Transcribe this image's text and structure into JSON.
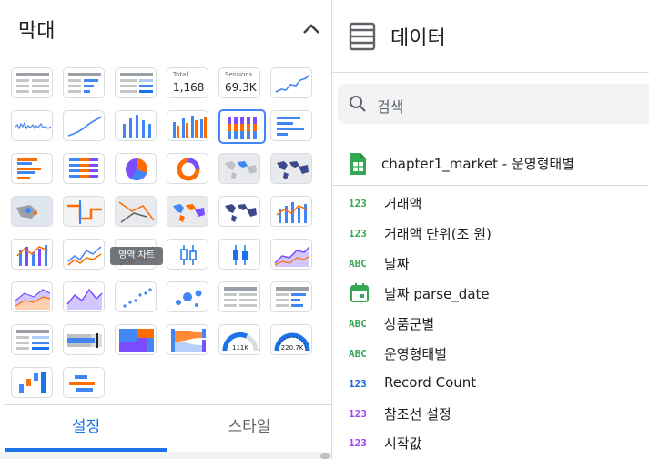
{
  "chart_panel": {
    "title": "막대",
    "scorecard_total": {
      "label": "Total",
      "value": "1,168"
    },
    "scorecard_sessions": {
      "label": "Sessions",
      "value": "69.3K"
    },
    "gauge_1_value": "111K",
    "gauge_2_value": "220.7K",
    "tooltip": "영역 차트",
    "tabs": [
      {
        "label": "설정",
        "active": true
      },
      {
        "label": "스타일",
        "active": false
      }
    ]
  },
  "data_panel": {
    "title": "데이터",
    "search_placeholder": "검색",
    "source_name": "chapter1_market - 운영형태별",
    "fields": [
      {
        "type": "123",
        "name": "거래액",
        "kind": "metric"
      },
      {
        "type": "123",
        "name": "거래액 단위(조 원)",
        "kind": "metric"
      },
      {
        "type": "ABC",
        "name": "날짜",
        "kind": "dimension"
      },
      {
        "type": "calendar",
        "name": "날짜 parse_date",
        "kind": "date"
      },
      {
        "type": "ABC",
        "name": "상품군별",
        "kind": "dimension"
      },
      {
        "type": "ABC",
        "name": "운영형태별",
        "kind": "dimension"
      },
      {
        "type": "123",
        "name": "Record Count",
        "kind": "count"
      },
      {
        "type": "123",
        "name": "참조선 설정",
        "kind": "param"
      },
      {
        "type": "123",
        "name": "시작값",
        "kind": "param"
      }
    ]
  },
  "colors": {
    "accent": "#1a73e8",
    "metric_green": "#34a853",
    "count_blue": "#1967d2",
    "param_purple": "#a142f4",
    "chart_blue": "#4285f4",
    "chart_orange": "#ff6d00",
    "chart_purple": "#7b4dff"
  }
}
